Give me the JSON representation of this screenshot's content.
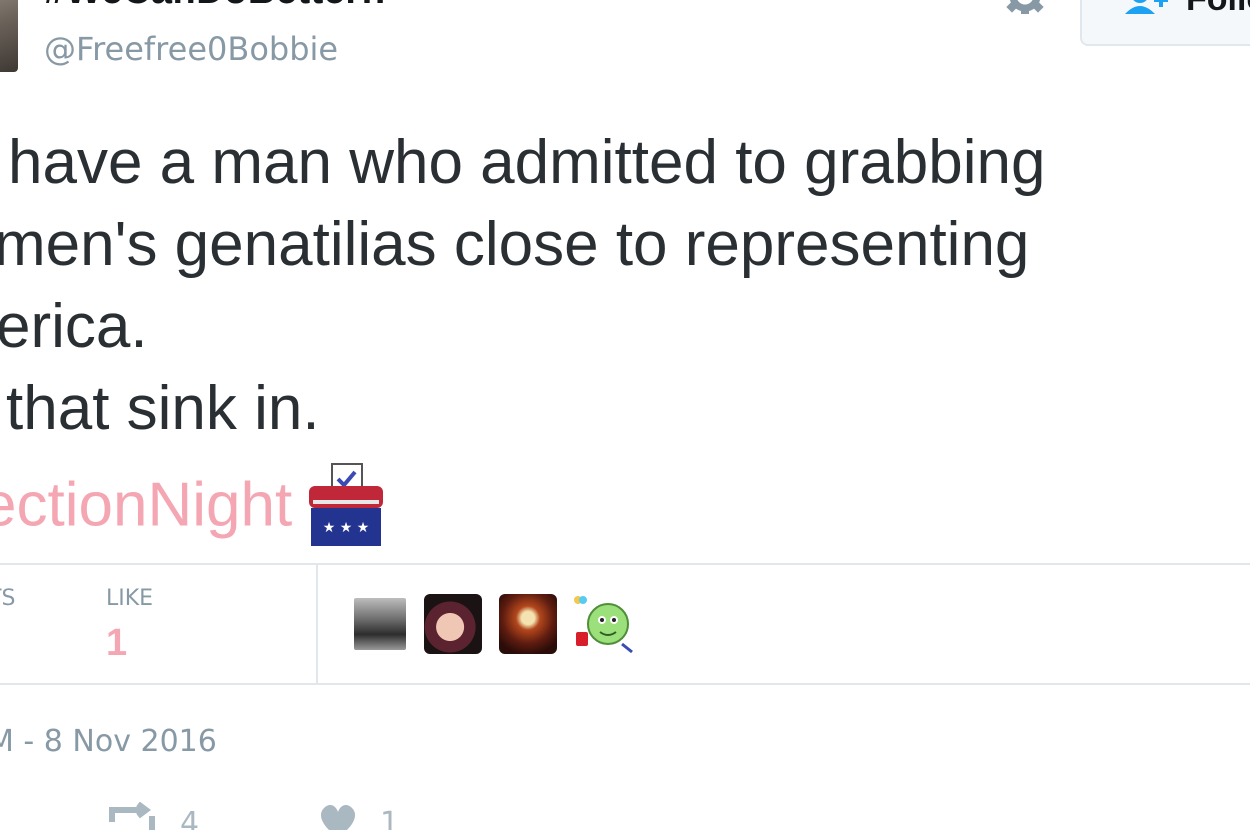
{
  "header": {
    "display_name": "#WeCanDoBetter!!",
    "handle": "@Freefree0Bobbie",
    "settings_icon": "gear-icon",
    "follow_label": "Follow",
    "follow_icon": "add-user-icon"
  },
  "tweet": {
    "lines": [
      "have a man who admitted to grabbing",
      "men's genatilias close to representing",
      "erica.",
      "that sink in."
    ],
    "hashtag": "ectionNight",
    "emoji": "ballot-box-icon"
  },
  "stats": {
    "retweets_label": "TS",
    "likes_label": "LIKE",
    "likes_value": "1",
    "likers_count": 4
  },
  "timestamp": "M - 8 Nov 2016",
  "actions": {
    "retweet_count": "4",
    "like_count": "1",
    "retweet_icon": "retweet-icon",
    "like_icon": "heart-icon",
    "more_icon": "more-icon"
  },
  "colors": {
    "text": "#292f33",
    "muted": "#8899a6",
    "hashtag": "#f4a7b3",
    "follow_accent": "#1da1f2",
    "divider": "#e1e8ed"
  }
}
